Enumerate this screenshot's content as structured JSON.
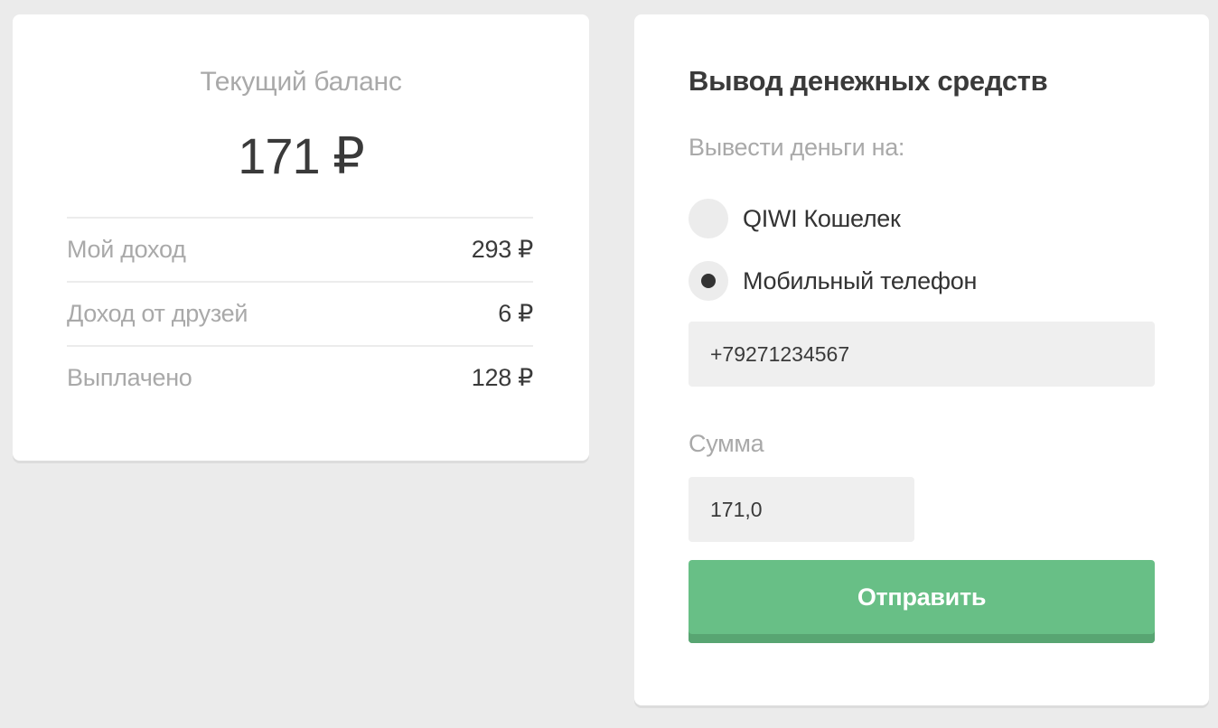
{
  "balance_card": {
    "title": "Текущий баланс",
    "amount": "171 ₽",
    "stats": [
      {
        "label": "Мой доход",
        "value": "293 ₽"
      },
      {
        "label": "Доход от друзей",
        "value": "6 ₽"
      },
      {
        "label": "Выплачено",
        "value": "128 ₽"
      }
    ]
  },
  "withdraw_card": {
    "title": "Вывод денежных средств",
    "subtitle": "Вывести деньги на:",
    "options": [
      {
        "label": "QIWI Кошелек",
        "selected": false
      },
      {
        "label": "Мобильный телефон",
        "selected": true
      }
    ],
    "phone_value": "+79271234567",
    "sum_label": "Сумма",
    "sum_value": "171,0",
    "submit_label": "Отправить"
  },
  "colors": {
    "background": "#ebebeb",
    "card": "#ffffff",
    "accent_green": "#68bf86",
    "muted_text": "#a9a9a9",
    "dark_text": "#3a3a3a"
  }
}
